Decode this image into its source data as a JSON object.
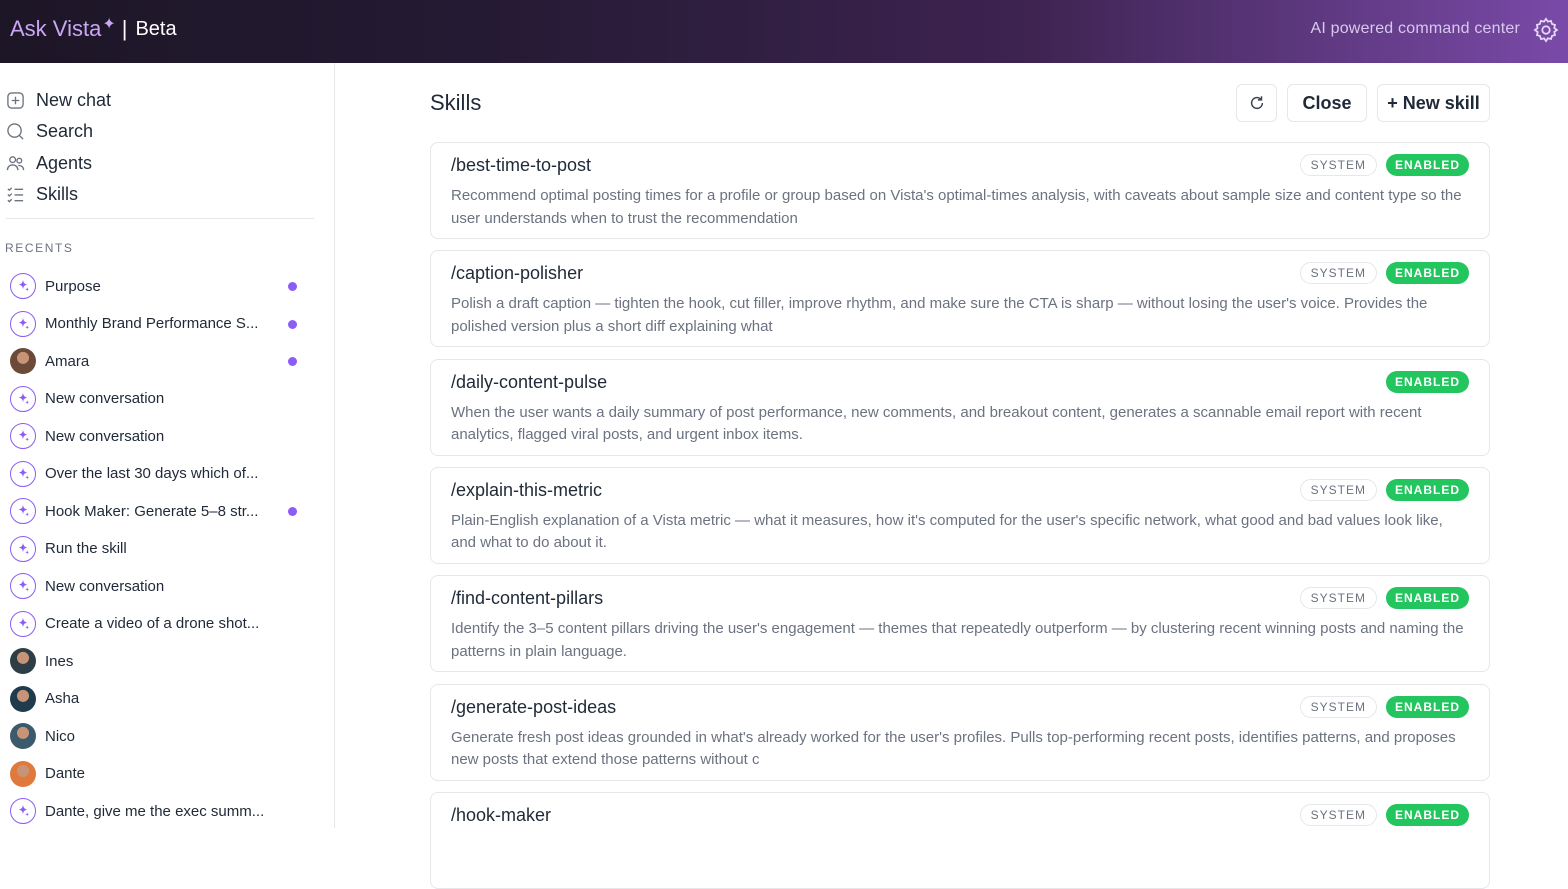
{
  "header": {
    "brand_name": "Ask Vista",
    "brand_separator": "|",
    "brand_tag": "Beta",
    "tagline": "AI powered command center",
    "accent_color": "#8b5cf6",
    "settings_icon": "gear-icon"
  },
  "sidebar": {
    "nav": [
      {
        "label": "New chat",
        "icon": "new-chat-icon"
      },
      {
        "label": "Search",
        "icon": "search-icon"
      },
      {
        "label": "Agents",
        "icon": "agents-icon"
      },
      {
        "label": "Skills",
        "icon": "skills-list-icon"
      }
    ],
    "recents_label": "RECENTS",
    "recents": [
      {
        "title": "Purpose",
        "icon": "sparkle-icon",
        "unread": true
      },
      {
        "title": "Monthly Brand Performance S...",
        "icon": "sparkle-icon",
        "unread": true
      },
      {
        "title": "Amara",
        "icon": "avatar",
        "unread": true
      },
      {
        "title": "New conversation",
        "icon": "sparkle-icon",
        "unread": false
      },
      {
        "title": "New conversation",
        "icon": "sparkle-icon",
        "unread": false
      },
      {
        "title": "Over the last 30 days which of...",
        "icon": "sparkle-icon",
        "unread": false
      },
      {
        "title": "Hook Maker: Generate 5–8 str...",
        "icon": "sparkle-icon",
        "unread": true
      },
      {
        "title": "Run the skill",
        "icon": "sparkle-icon",
        "unread": false
      },
      {
        "title": "New conversation",
        "icon": "sparkle-icon",
        "unread": false
      },
      {
        "title": "Create a video of a drone shot...",
        "icon": "sparkle-icon",
        "unread": false
      },
      {
        "title": "Ines",
        "icon": "avatar",
        "unread": false
      },
      {
        "title": "Asha",
        "icon": "avatar",
        "unread": false
      },
      {
        "title": "Nico",
        "icon": "avatar",
        "unread": false
      },
      {
        "title": "Dante",
        "icon": "avatar",
        "unread": false
      },
      {
        "title": "Dante, give me the exec summ...",
        "icon": "sparkle-icon",
        "unread": false
      }
    ]
  },
  "main": {
    "title": "Skills",
    "refresh_icon": "refresh-icon",
    "close_label": "Close",
    "new_skill_label": "+ New skill",
    "status_colors": {
      "enabled": "#22c55e"
    },
    "skills": [
      {
        "name": "/best-time-to-post",
        "system": "SYSTEM",
        "status": "ENABLED",
        "description": "Recommend optimal posting times for a profile or group based on Vista's optimal-times analysis, with caveats about sample size and content type so the user understands when to trust the recommendation"
      },
      {
        "name": "/caption-polisher",
        "system": "SYSTEM",
        "status": "ENABLED",
        "description": "Polish a draft caption — tighten the hook, cut filler, improve rhythm, and make sure the CTA is sharp — without losing the user's voice. Provides the polished version plus a short diff explaining what"
      },
      {
        "name": "/daily-content-pulse",
        "system": null,
        "status": "ENABLED",
        "description": "When the user wants a daily summary of post performance, new comments, and breakout content, generates a scannable email report with recent analytics, flagged viral posts, and urgent inbox items."
      },
      {
        "name": "/explain-this-metric",
        "system": "SYSTEM",
        "status": "ENABLED",
        "description": "Plain-English explanation of a Vista metric — what it measures, how it's computed for the user's specific network, what good and bad values look like, and what to do about it."
      },
      {
        "name": "/find-content-pillars",
        "system": "SYSTEM",
        "status": "ENABLED",
        "description": "Identify the 3–5 content pillars driving the user's engagement — themes that repeatedly outperform — by clustering recent winning posts and naming the patterns in plain language."
      },
      {
        "name": "/generate-post-ideas",
        "system": "SYSTEM",
        "status": "ENABLED",
        "description": "Generate fresh post ideas grounded in what's already worked for the user's profiles. Pulls top-performing recent posts, identifies patterns, and proposes new posts that extend those patterns without c"
      },
      {
        "name": "/hook-maker",
        "system": "SYSTEM",
        "status": "ENABLED",
        "description": ""
      }
    ]
  }
}
